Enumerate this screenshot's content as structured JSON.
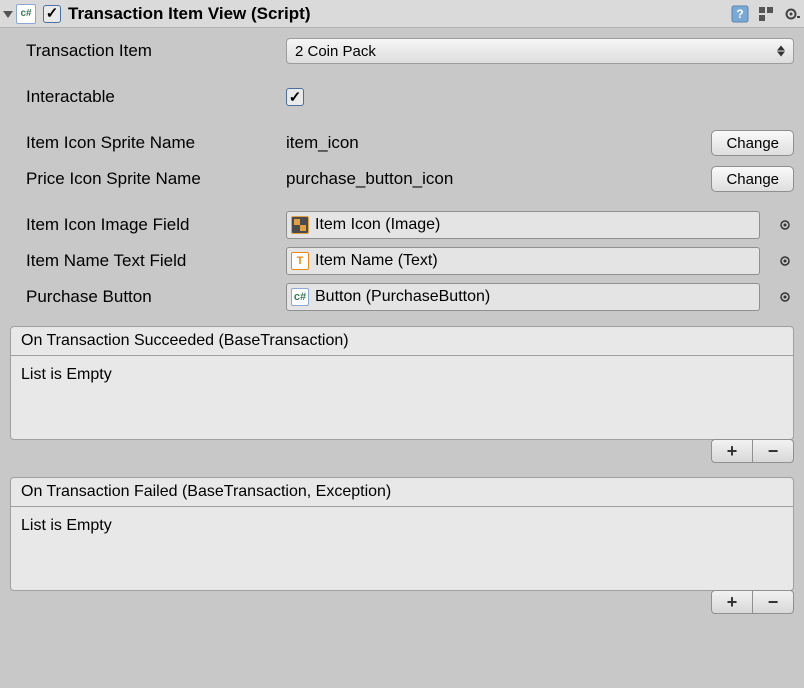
{
  "header": {
    "enabled": true,
    "title": "Transaction Item View (Script)"
  },
  "fields": {
    "transactionItem": {
      "label": "Transaction Item",
      "value": "2 Coin Pack"
    },
    "interactable": {
      "label": "Interactable",
      "checked": true
    },
    "itemIconSpriteName": {
      "label": "Item Icon Sprite Name",
      "value": "item_icon",
      "button": "Change"
    },
    "priceIconSpriteName": {
      "label": "Price Icon Sprite Name",
      "value": "purchase_button_icon",
      "button": "Change"
    },
    "itemIconImageField": {
      "label": "Item Icon Image Field",
      "value": "Item Icon (Image)"
    },
    "itemNameTextField": {
      "label": "Item Name Text Field",
      "value": "Item Name (Text)"
    },
    "purchaseButton": {
      "label": "Purchase Button",
      "value": "Button (PurchaseButton)"
    }
  },
  "events": {
    "succeeded": {
      "title": "On Transaction Succeeded (BaseTransaction)",
      "empty": "List is Empty"
    },
    "failed": {
      "title": "On Transaction Failed (BaseTransaction, Exception)",
      "empty": "List is Empty"
    }
  },
  "icons": {
    "script_text": "c#",
    "plus": "+",
    "minus": "−",
    "check": "✓",
    "text_icon": "T"
  }
}
